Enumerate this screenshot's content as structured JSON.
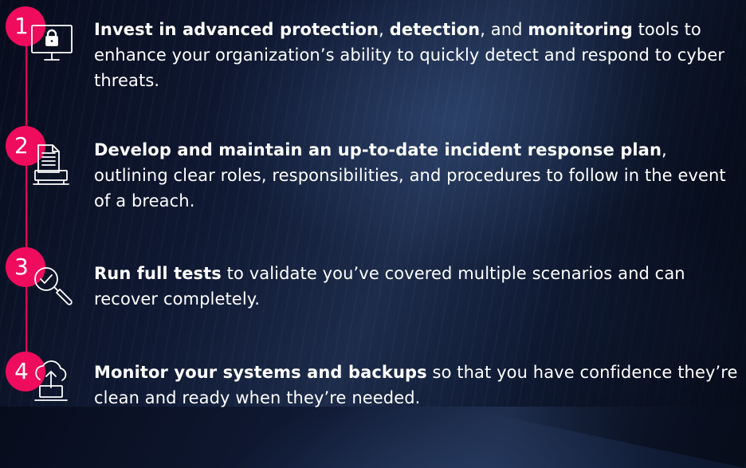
{
  "steps": [
    {
      "number": "1",
      "icon": "monitor-lock-icon",
      "segments": [
        {
          "text": "Invest in advanced protection",
          "bold": true
        },
        {
          "text": ", ",
          "bold": false
        },
        {
          "text": "detection",
          "bold": true
        },
        {
          "text": ", and ",
          "bold": false
        },
        {
          "text": "monitoring",
          "bold": true
        },
        {
          "text": " tools to enhance your organization’s ability to quickly detect and respond to cyber threats.",
          "bold": false
        }
      ]
    },
    {
      "number": "2",
      "icon": "document-plan-icon",
      "segments": [
        {
          "text": "Develop and maintain an up-to-date incident response plan",
          "bold": true
        },
        {
          "text": ", outlining clear roles, responsibilities, and procedures to follow in the event of a breach.",
          "bold": false
        }
      ]
    },
    {
      "number": "3",
      "icon": "magnifier-check-icon",
      "segments": [
        {
          "text": "Run full tests",
          "bold": true
        },
        {
          "text": " to validate you’ve covered multiple scenarios and can recover completely.",
          "bold": false
        }
      ]
    },
    {
      "number": "4",
      "icon": "cloud-upload-icon",
      "segments": [
        {
          "text": "Monitor your systems and backups",
          "bold": true
        },
        {
          "text": " so that you have confidence they’re clean and ready when they’re needed.",
          "bold": false
        }
      ]
    }
  ],
  "colors": {
    "accent": "#ef0c5c",
    "text": "#ffffff",
    "background": "#101a34"
  }
}
